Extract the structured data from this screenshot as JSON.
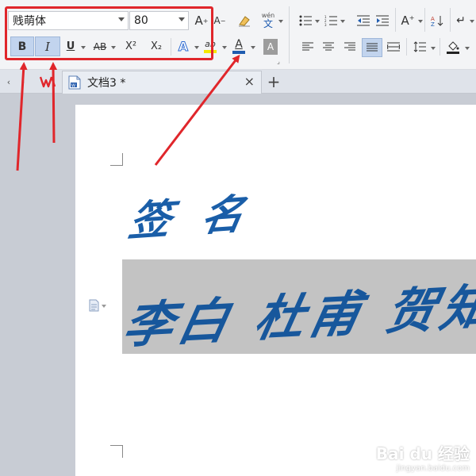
{
  "toolbar": {
    "font_name": "贱萌体",
    "font_size": "80",
    "grow_font": "A",
    "shrink_font": "A",
    "phonetic": "wén",
    "phonetic_char": "文",
    "bold": "B",
    "italic": "I",
    "underline": "U",
    "strikethrough": "AB",
    "superscript": "X²",
    "subscript": "X₂",
    "text_effect": "A",
    "highlight": "ab",
    "font_color": "A",
    "char_shading": "A",
    "font_color_hex": "#1f5cb0",
    "highlight_color_hex": "#f5e800"
  },
  "tab": {
    "label": "文档3 *",
    "close": "×",
    "new_tab": "+"
  },
  "document": {
    "heading": "签 名",
    "signatures": "李白 杜甫 贺知"
  },
  "watermark": {
    "brand": "Bai du 经验",
    "url": "jingyan.baidu.com"
  }
}
